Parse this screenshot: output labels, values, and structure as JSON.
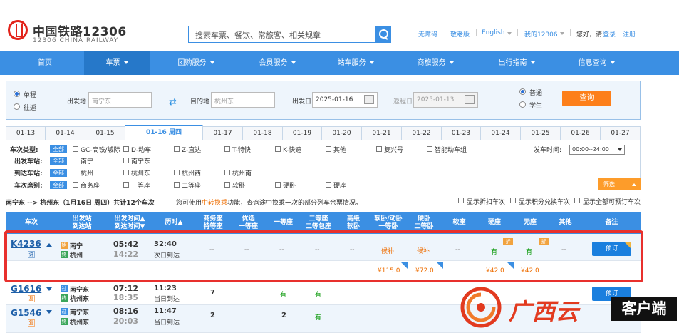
{
  "header": {
    "logo_cn": "中国铁路12306",
    "logo_en": "12306 CHINA RAILWAY",
    "search_placeholder": "搜索车票、餐饮、常旅客、相关规章",
    "links": {
      "accessible": "无障碍",
      "elder": "敬老版",
      "english": "English",
      "my12306": "我的12306",
      "hello": "您好，请",
      "login": "登录",
      "register": "注册"
    }
  },
  "nav": [
    "首页",
    "车票",
    "团购服务",
    "会员服务",
    "站车服务",
    "商旅服务",
    "出行指南",
    "信息查询"
  ],
  "query": {
    "oneway": "单程",
    "roundtrip": "往返",
    "from_label": "出发地",
    "from_value": "南宁东",
    "to_label": "目的地",
    "to_value": "杭州东",
    "date_label": "出发日",
    "date_value": "2025-01-16",
    "return_label": "返程日",
    "return_value": "2025-01-13",
    "normal": "普通",
    "student": "学生",
    "query_button": "查询"
  },
  "date_tabs": [
    "01-13",
    "01-14",
    "01-15",
    "01-16 周四",
    "01-17",
    "01-18",
    "01-19",
    "01-20",
    "01-21",
    "01-22",
    "01-23",
    "01-24",
    "01-25",
    "01-26",
    "01-27"
  ],
  "filters": {
    "type_label": "车次类型:",
    "all": "全部",
    "types": [
      "GC-高铁/城际",
      "D-动车",
      "Z-直达",
      "T-特快",
      "K-快速",
      "其他",
      "复兴号",
      "智能动车组"
    ],
    "depart_time_label": "发车时间:",
    "depart_time_value": "00:00--24:00",
    "from_station_label": "出发车站:",
    "from_stations": [
      "南宁",
      "南宁东"
    ],
    "to_station_label": "到达车站:",
    "to_stations": [
      "杭州",
      "杭州东",
      "杭州西",
      "杭州南"
    ],
    "seat_label": "车次席别:",
    "seats": [
      "商务座",
      "一等座",
      "二等座",
      "软卧",
      "硬卧",
      "硬座"
    ],
    "filter_button": "筛选"
  },
  "info": {
    "route": "南宁东 --> 杭州东（1月16日 周四）共计12个车次",
    "text_before": "您可使用",
    "text_highlight": "中转换乘",
    "text_after": "功能，查询途中换乘一次的部分列车余票情况。",
    "opt1": "显示折扣车次",
    "opt2": "显示积分兑换车次",
    "opt3": "显示全部可预订车次"
  },
  "table_headers": {
    "train": "车次",
    "stations": "出发站\n到达站",
    "times": "出发时间▲\n到达时间▼",
    "duration": "历时▲",
    "business": "商务座\n特等座",
    "premium": "优选\n一等座",
    "first": "一等座",
    "second": "二等座\n二等包座",
    "hsoft": "高级\n软卧",
    "soft_sleeper": "软卧/动卧\n一等卧",
    "hard_sleeper": "硬卧\n二等卧",
    "soft_seat": "软座",
    "hard_seat": "硬座",
    "no_seat": "无座",
    "other": "其他",
    "remark": "备注"
  },
  "rows": [
    {
      "train": "K4236",
      "tag": "详",
      "from": "南宁",
      "to": "杭州",
      "badge_from": "始",
      "badge_to": "终",
      "dep": "05:42",
      "arr": "14:22",
      "dur": "32:40",
      "dur_sub": "次日到达",
      "business": "--",
      "premium": "--",
      "first": "--",
      "second": "--",
      "hsoft": "--",
      "soft_sleeper": "候补",
      "hard_sleeper": "候补",
      "soft_seat": "--",
      "hard_seat": "有",
      "no_seat": "有",
      "other": "--",
      "zhe": "折",
      "book": "预订",
      "prices": {
        "soft_sleeper": "¥115.0",
        "hard_sleeper": "¥72.0",
        "hard_seat": "¥42.0",
        "no_seat": "¥42.0"
      }
    },
    {
      "train": "G1616",
      "tag": "复",
      "from": "南宁东",
      "to": "杭州东",
      "badge_from": "过",
      "badge_to": "终",
      "dep": "07:12",
      "arr": "18:35",
      "dur": "11:23",
      "dur_sub": "当日到达",
      "business": "7",
      "first": "有",
      "second": "有",
      "book": "预订"
    },
    {
      "train": "G1546",
      "tag": "复",
      "from": "南宁东",
      "to": "杭州东",
      "badge_from": "过",
      "badge_to": "终",
      "dep": "08:16",
      "arr": "20:03",
      "dur": "11:47",
      "dur_sub": "当日到达",
      "business": "2",
      "first": "2",
      "second": "有"
    }
  ],
  "watermark": {
    "logo_text": "广西云",
    "client": "客户端"
  },
  "colors": {
    "primary": "#3b8fe3",
    "orange": "#fd7f1a",
    "available": "#109c10",
    "highlight": "#e8302d"
  }
}
